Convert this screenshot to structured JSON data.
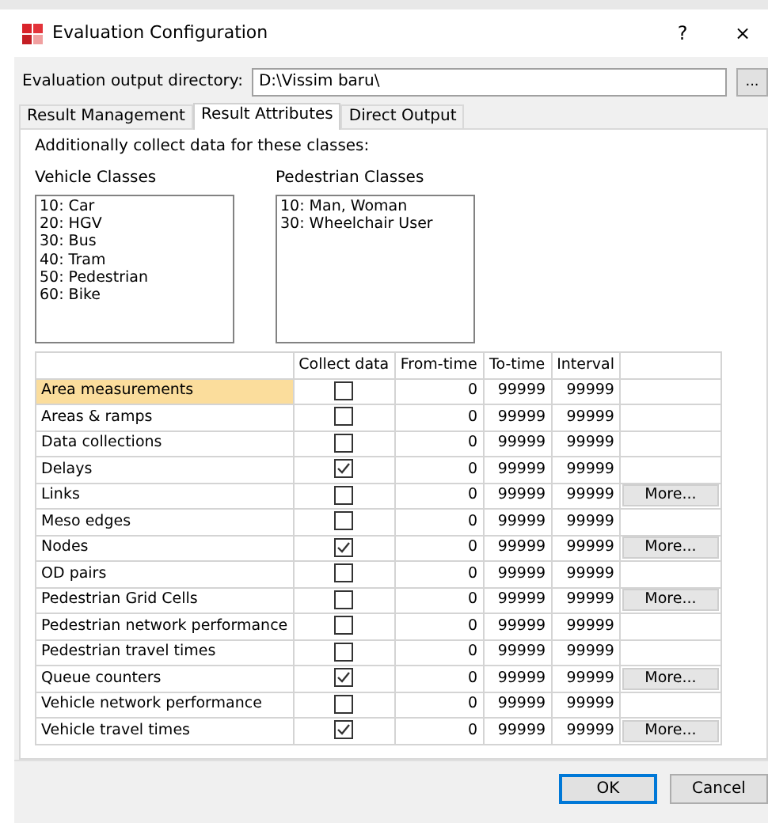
{
  "window": {
    "title": "Evaluation Configuration",
    "help": "?",
    "close": "×"
  },
  "output_directory": {
    "label": "Evaluation output directory:",
    "value": "D:\\Vissim baru\\",
    "browse": "..."
  },
  "tabs": [
    {
      "label": "Result Management",
      "selected": false
    },
    {
      "label": "Result Attributes",
      "selected": true
    },
    {
      "label": "Direct Output",
      "selected": false
    }
  ],
  "section_label": "Additionally collect data for these classes:",
  "vehicle_classes": {
    "label": "Vehicle Classes",
    "items": [
      "10: Car",
      "20: HGV",
      "30: Bus",
      "40: Tram",
      "50: Pedestrian",
      "60: Bike"
    ]
  },
  "pedestrian_classes": {
    "label": "Pedestrian Classes",
    "items": [
      "10: Man, Woman",
      "30: Wheelchair User"
    ]
  },
  "table": {
    "columns": [
      "Collect data",
      "From-time",
      "To-time",
      "Interval"
    ],
    "rows": [
      {
        "name": "Area measurements",
        "selected": true,
        "collect_data": false,
        "from_time": "0",
        "to_time": "99999",
        "interval": "99999"
      },
      {
        "name": "Areas & ramps",
        "selected": false,
        "collect_data": false,
        "from_time": "0",
        "to_time": "99999",
        "interval": "99999"
      },
      {
        "name": "Data collections",
        "selected": false,
        "collect_data": false,
        "from_time": "0",
        "to_time": "99999",
        "interval": "99999"
      },
      {
        "name": "Delays",
        "selected": false,
        "collect_data": true,
        "from_time": "0",
        "to_time": "99999",
        "interval": "99999"
      },
      {
        "name": "Links",
        "selected": false,
        "collect_data": false,
        "from_time": "0",
        "to_time": "99999",
        "interval": "99999",
        "more": "More..."
      },
      {
        "name": "Meso edges",
        "selected": false,
        "collect_data": false,
        "from_time": "0",
        "to_time": "99999",
        "interval": "99999"
      },
      {
        "name": "Nodes",
        "selected": false,
        "collect_data": true,
        "from_time": "0",
        "to_time": "99999",
        "interval": "99999",
        "more": "More..."
      },
      {
        "name": "OD pairs",
        "selected": false,
        "collect_data": false,
        "from_time": "0",
        "to_time": "99999",
        "interval": "99999"
      },
      {
        "name": "Pedestrian Grid Cells",
        "selected": false,
        "collect_data": false,
        "from_time": "0",
        "to_time": "99999",
        "interval": "99999",
        "more": "More..."
      },
      {
        "name": "Pedestrian network performance",
        "selected": false,
        "collect_data": false,
        "from_time": "0",
        "to_time": "99999",
        "interval": "99999"
      },
      {
        "name": "Pedestrian travel times",
        "selected": false,
        "collect_data": false,
        "from_time": "0",
        "to_time": "99999",
        "interval": "99999"
      },
      {
        "name": "Queue counters",
        "selected": false,
        "collect_data": true,
        "from_time": "0",
        "to_time": "99999",
        "interval": "99999",
        "more": "More..."
      },
      {
        "name": "Vehicle network performance",
        "selected": false,
        "collect_data": false,
        "from_time": "0",
        "to_time": "99999",
        "interval": "99999"
      },
      {
        "name": "Vehicle travel times",
        "selected": false,
        "collect_data": true,
        "from_time": "0",
        "to_time": "99999",
        "interval": "99999",
        "more": "More..."
      }
    ]
  },
  "buttons": [
    {
      "label": "OK",
      "default": true
    },
    {
      "label": "Cancel",
      "default": false
    }
  ]
}
